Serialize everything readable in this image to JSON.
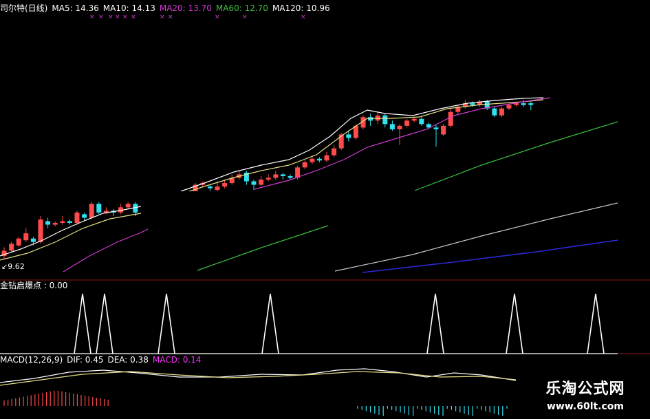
{
  "legend": {
    "stock": "司尔特(日线)",
    "ma5": "MA5: 14.36",
    "ma10": "MA10: 14.13",
    "ma20": "MA20: 13.70",
    "ma60": "MA60: 12.70",
    "ma120": "MA120: 10.96"
  },
  "colors": {
    "up": "#ff4b4b",
    "down": "#33e0f0",
    "ma5": "#ffffff",
    "ma10": "#e8e08a",
    "ma20": "#d23bd2",
    "ma60": "#3fc13f",
    "ma120": "#c8c8c8",
    "ma250": "#2a2ad8",
    "grid": "#8a1a1a",
    "macd_label": "#ff33ff"
  },
  "low_label": "9.62",
  "indicator": {
    "label": "金钻启爆点 : 0.00"
  },
  "macd": {
    "label": "MACD(12,26,9)",
    "dif": "DIF: 0.45",
    "dea": "DEA: 0.38",
    "macd": "MACD: 0.14"
  },
  "watermark": {
    "title": "乐淘公式网",
    "url": "www.60lt.com"
  },
  "chart_data": {
    "type": "candlestick",
    "price_range": [
      9.6,
      14.6
    ],
    "candles": [
      {
        "o": 9.8,
        "c": 9.95,
        "h": 10.05,
        "l": 9.7,
        "dir": "up"
      },
      {
        "o": 9.95,
        "c": 10.15,
        "h": 10.2,
        "l": 9.9,
        "dir": "up"
      },
      {
        "o": 10.1,
        "c": 10.3,
        "h": 10.35,
        "l": 10.05,
        "dir": "up"
      },
      {
        "o": 10.25,
        "c": 10.45,
        "h": 10.6,
        "l": 10.2,
        "dir": "up"
      },
      {
        "o": 10.3,
        "c": 10.2,
        "h": 10.35,
        "l": 10.1,
        "dir": "down"
      },
      {
        "o": 10.2,
        "c": 10.85,
        "h": 10.95,
        "l": 10.15,
        "dir": "up"
      },
      {
        "o": 10.8,
        "c": 10.7,
        "h": 10.9,
        "l": 10.6,
        "dir": "down"
      },
      {
        "o": 10.7,
        "c": 10.75,
        "h": 10.8,
        "l": 10.65,
        "dir": "up"
      },
      {
        "o": 10.75,
        "c": 10.8,
        "h": 10.95,
        "l": 10.7,
        "dir": "up"
      },
      {
        "o": 10.8,
        "c": 10.75,
        "h": 10.85,
        "l": 10.7,
        "dir": "down"
      },
      {
        "o": 10.75,
        "c": 11.05,
        "h": 11.1,
        "l": 10.7,
        "dir": "up"
      },
      {
        "o": 11.0,
        "c": 10.9,
        "h": 11.05,
        "l": 10.8,
        "dir": "down"
      },
      {
        "o": 10.9,
        "c": 11.3,
        "h": 11.35,
        "l": 10.85,
        "dir": "up"
      },
      {
        "o": 11.3,
        "c": 11.05,
        "h": 11.35,
        "l": 11.0,
        "dir": "down"
      },
      {
        "o": 11.05,
        "c": 11.1,
        "h": 11.2,
        "l": 11.0,
        "dir": "up"
      },
      {
        "o": 11.1,
        "c": 11.05,
        "h": 11.15,
        "l": 10.95,
        "dir": "down"
      },
      {
        "o": 11.05,
        "c": 11.2,
        "h": 11.3,
        "l": 11.0,
        "dir": "up"
      },
      {
        "o": 11.2,
        "c": 11.3,
        "h": 11.35,
        "l": 11.15,
        "dir": "up"
      },
      {
        "o": 11.3,
        "c": 11.05,
        "h": 11.35,
        "l": 10.95,
        "dir": "down"
      }
    ],
    "candles2": [
      {
        "o": 11.5,
        "c": 11.55,
        "h": 11.6,
        "l": 11.45,
        "dir": "up"
      },
      {
        "o": 11.55,
        "c": 11.6,
        "h": 11.65,
        "l": 11.5,
        "dir": "up"
      },
      {
        "o": 11.55,
        "c": 11.85,
        "h": 11.9,
        "l": 11.5,
        "dir": "up"
      },
      {
        "o": 11.85,
        "c": 11.9,
        "h": 11.95,
        "l": 11.8,
        "dir": "up"
      },
      {
        "o": 11.8,
        "c": 11.75,
        "h": 11.85,
        "l": 11.6,
        "dir": "down"
      },
      {
        "o": 11.7,
        "c": 11.8,
        "h": 11.95,
        "l": 11.55,
        "dir": "up"
      },
      {
        "o": 11.8,
        "c": 11.9,
        "h": 12.0,
        "l": 11.75,
        "dir": "up"
      },
      {
        "o": 11.9,
        "c": 12.05,
        "h": 12.15,
        "l": 11.85,
        "dir": "up"
      },
      {
        "o": 12.05,
        "c": 12.15,
        "h": 12.25,
        "l": 12.0,
        "dir": "up"
      },
      {
        "o": 12.2,
        "c": 11.95,
        "h": 12.25,
        "l": 11.85,
        "dir": "down"
      },
      {
        "o": 11.95,
        "c": 11.85,
        "h": 12.0,
        "l": 11.7,
        "dir": "down"
      },
      {
        "o": 11.85,
        "c": 12.0,
        "h": 12.1,
        "l": 11.8,
        "dir": "up"
      },
      {
        "o": 12.0,
        "c": 12.05,
        "h": 12.15,
        "l": 11.95,
        "dir": "up"
      },
      {
        "o": 12.05,
        "c": 12.15,
        "h": 12.25,
        "l": 12.0,
        "dir": "up"
      },
      {
        "o": 12.15,
        "c": 12.1,
        "h": 12.2,
        "l": 12.0,
        "dir": "down"
      },
      {
        "o": 12.1,
        "c": 12.05,
        "h": 12.15,
        "l": 12.0,
        "dir": "down"
      },
      {
        "o": 12.05,
        "c": 12.35,
        "h": 12.4,
        "l": 12.0,
        "dir": "up"
      },
      {
        "o": 12.35,
        "c": 12.5,
        "h": 12.55,
        "l": 12.3,
        "dir": "up"
      },
      {
        "o": 12.5,
        "c": 12.6,
        "h": 12.7,
        "l": 12.45,
        "dir": "up"
      },
      {
        "o": 12.6,
        "c": 12.55,
        "h": 12.65,
        "l": 12.5,
        "dir": "down"
      },
      {
        "o": 12.55,
        "c": 12.7,
        "h": 12.8,
        "l": 12.5,
        "dir": "up"
      },
      {
        "o": 12.7,
        "c": 12.9,
        "h": 13.0,
        "l": 12.65,
        "dir": "up"
      },
      {
        "o": 12.9,
        "c": 13.3,
        "h": 13.35,
        "l": 12.85,
        "dir": "up"
      },
      {
        "o": 13.3,
        "c": 13.2,
        "h": 13.4,
        "l": 13.1,
        "dir": "down"
      },
      {
        "o": 13.2,
        "c": 13.55,
        "h": 13.6,
        "l": 13.15,
        "dir": "up"
      },
      {
        "o": 13.5,
        "c": 13.8,
        "h": 13.85,
        "l": 13.45,
        "dir": "up"
      },
      {
        "o": 13.8,
        "c": 13.7,
        "h": 13.9,
        "l": 13.55,
        "dir": "down"
      },
      {
        "o": 13.7,
        "c": 13.85,
        "h": 13.95,
        "l": 13.6,
        "dir": "up"
      },
      {
        "o": 13.85,
        "c": 13.6,
        "h": 13.9,
        "l": 13.5,
        "dir": "down"
      },
      {
        "o": 13.6,
        "c": 13.45,
        "h": 13.7,
        "l": 13.4,
        "dir": "down"
      },
      {
        "o": 13.45,
        "c": 13.55,
        "h": 13.6,
        "l": 13.0,
        "dir": "up"
      },
      {
        "o": 13.55,
        "c": 13.7,
        "h": 13.75,
        "l": 13.5,
        "dir": "up"
      },
      {
        "o": 13.7,
        "c": 13.75,
        "h": 13.8,
        "l": 13.65,
        "dir": "up"
      },
      {
        "o": 13.75,
        "c": 13.6,
        "h": 13.8,
        "l": 13.55,
        "dir": "down"
      },
      {
        "o": 13.6,
        "c": 13.5,
        "h": 13.65,
        "l": 13.45,
        "dir": "down"
      },
      {
        "o": 13.5,
        "c": 13.45,
        "h": 13.6,
        "l": 12.95,
        "dir": "down"
      },
      {
        "o": 13.3,
        "c": 13.55,
        "h": 13.6,
        "l": 13.25,
        "dir": "up"
      },
      {
        "o": 13.55,
        "c": 13.95,
        "h": 14.05,
        "l": 13.5,
        "dir": "up"
      },
      {
        "o": 13.95,
        "c": 14.1,
        "h": 14.15,
        "l": 13.9,
        "dir": "up"
      },
      {
        "o": 14.1,
        "c": 14.2,
        "h": 14.3,
        "l": 14.05,
        "dir": "up"
      },
      {
        "o": 14.2,
        "c": 14.15,
        "h": 14.25,
        "l": 14.1,
        "dir": "down"
      },
      {
        "o": 14.15,
        "c": 14.25,
        "h": 14.3,
        "l": 14.1,
        "dir": "up"
      },
      {
        "o": 14.25,
        "c": 14.05,
        "h": 14.3,
        "l": 14.0,
        "dir": "down"
      },
      {
        "o": 14.05,
        "c": 13.85,
        "h": 14.1,
        "l": 13.8,
        "dir": "down"
      },
      {
        "o": 13.85,
        "c": 14.05,
        "h": 14.1,
        "l": 13.8,
        "dir": "up"
      },
      {
        "o": 14.05,
        "c": 14.15,
        "h": 14.2,
        "l": 14.0,
        "dir": "up"
      },
      {
        "o": 14.15,
        "c": 14.2,
        "h": 14.25,
        "l": 14.1,
        "dir": "up"
      },
      {
        "o": 14.2,
        "c": 14.15,
        "h": 14.3,
        "l": 14.1,
        "dir": "down"
      },
      {
        "o": 14.15,
        "c": 14.2,
        "h": 14.25,
        "l": 14.0,
        "dir": "down"
      }
    ],
    "ma5": [
      9.85,
      10.0,
      10.15,
      10.3,
      10.4,
      10.55,
      10.65,
      10.75,
      10.8,
      10.85,
      10.9,
      10.95,
      11.05,
      11.1,
      11.1,
      11.15,
      11.15,
      11.15,
      11.2
    ],
    "ma20_segment": [
      9.75,
      9.95,
      10.15,
      10.35,
      10.55,
      10.7,
      10.85
    ],
    "signals_x": [
      120,
      152,
      242,
      393,
      633,
      748,
      866
    ],
    "macd_hist_up_count": 28
  }
}
